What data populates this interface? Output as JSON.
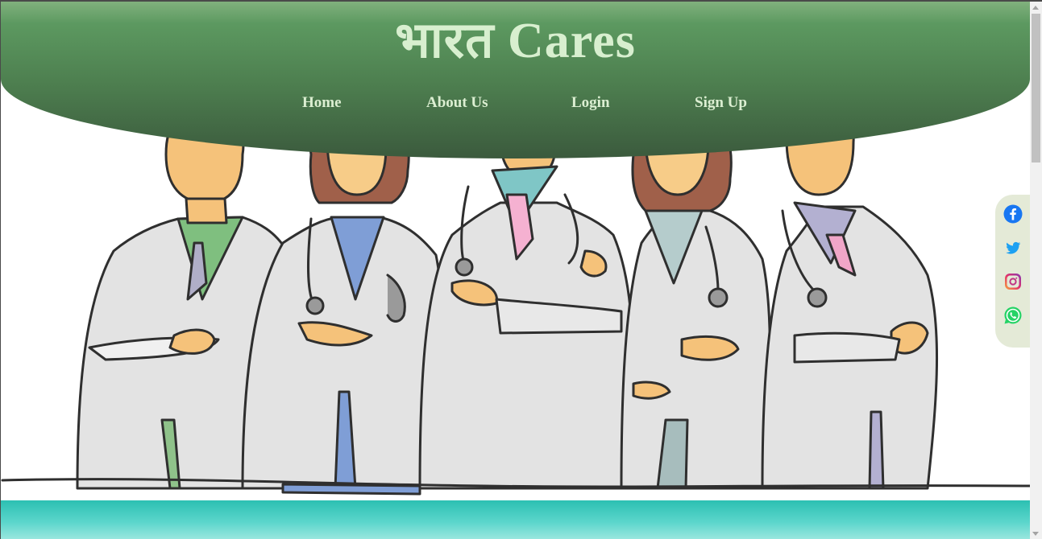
{
  "site": {
    "title": "भारत Cares"
  },
  "nav": {
    "items": [
      {
        "label": "Home"
      },
      {
        "label": "About Us"
      },
      {
        "label": "Login"
      },
      {
        "label": "Sign Up"
      }
    ]
  },
  "social": {
    "icons": [
      "facebook-icon",
      "twitter-icon",
      "instagram-icon",
      "whatsapp-icon"
    ]
  },
  "colors": {
    "header_top": "#9cc393",
    "header_bottom": "#3b5a3d",
    "title_text": "#d8efcf",
    "footer_band": "#2cc0b2"
  },
  "hero": {
    "image": "doctors-group-illustration"
  }
}
